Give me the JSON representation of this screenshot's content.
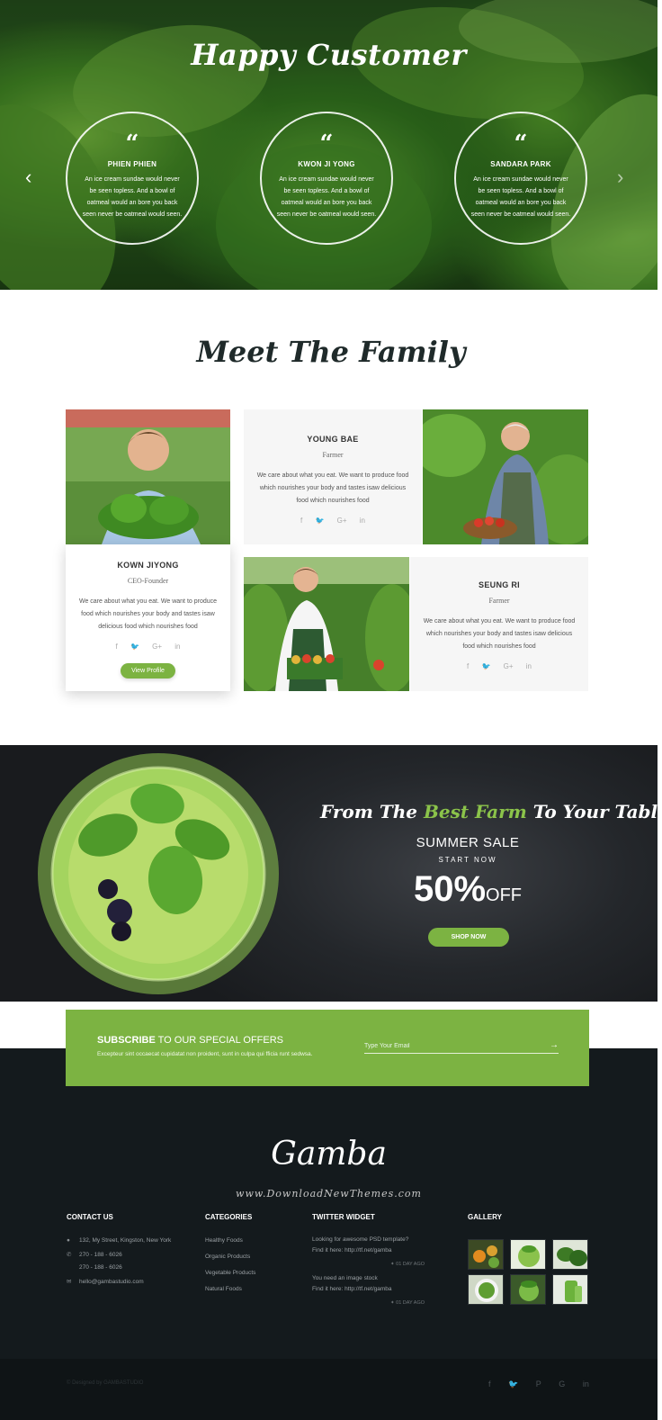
{
  "testimonials": {
    "title": "Happy Customer",
    "prev_icon": "chevron-left",
    "next_icon": "chevron-right",
    "items": [
      {
        "quote_mark": "“",
        "name": "PHIEN PHIEN",
        "text": "An ice cream sundae would never be seen topless. And a bowl of oatmeal would an bore you back seen never be oatmeal would seen."
      },
      {
        "quote_mark": "“",
        "name": "KWON JI YONG",
        "text": "An ice cream sundae would never be seen topless. And a bowl of oatmeal would an bore you back seen never be oatmeal would seen."
      },
      {
        "quote_mark": "“",
        "name": "SANDARA PARK",
        "text": "An ice cream sundae would never be seen topless. And a bowl of oatmeal would an bore you back seen never be oatmeal would seen."
      }
    ]
  },
  "family": {
    "title": "Meet The Family",
    "members": [
      {
        "name": "KOWN JIYONG",
        "role": "CEO-Founder",
        "text": "We care about what you eat. We want to produce food which nourishes your body and tastes isaw delicious food which nourishes food",
        "button": "View Profile"
      },
      {
        "name": "YOUNG BAE",
        "role": "Farmer",
        "text": "We care about what you eat. We want to produce food which nourishes your body and tastes isaw delicious food which nourishes food"
      },
      {
        "name": "SEUNG RI",
        "role": "Farmer",
        "text": "We care about what you eat. We want to produce food which nourishes your body and tastes isaw delicious food which nourishes food"
      }
    ],
    "social_icons": [
      "f",
      "🐦",
      "G+",
      "in"
    ]
  },
  "sale": {
    "heading_before": "From The ",
    "heading_accent": "Best Farm",
    "heading_after": " To Your Table",
    "subtitle": "SUMMER SALE",
    "start": "START NOW",
    "percent": "50%",
    "off": "OFF",
    "button": "SHOP NOW",
    "accent_color": "#8bc34a"
  },
  "subscribe": {
    "title_bold": "SUBSCRIBE",
    "title_rest": " TO OUR SPECIAL OFFERS",
    "desc": "Excepteur sint occaecat cupidatat non proident, sunt in culpa qui fficia runt sedwsa.",
    "placeholder": "Type Your Email",
    "send_icon": "→"
  },
  "footer": {
    "brand": "Gamba",
    "watermark": "www.DownloadNewThemes.com",
    "contact": {
      "title": "CONTACT US",
      "address": "132, My Street, Kingston, New York",
      "phone1": "270 - 188 - 6026",
      "phone2": "270 - 188 - 6026",
      "email": "hello@gambastudio.com"
    },
    "categories": {
      "title": "CATEGORIES",
      "items": [
        "Healthy Foods",
        "Organic Products",
        "Vegetable Products",
        "Natural Foods"
      ]
    },
    "twitter": {
      "title": "TWITTER WIDGET",
      "tweets": [
        {
          "line1": "Looking for awesome PSD template?",
          "line2": "Find it here: http://tf.net/gamba",
          "meta": "01 DAY AGO"
        },
        {
          "line1": "You need an image stock",
          "line2": "Find it here: http://tf.net/gamba",
          "meta": "01 DAY AGO"
        }
      ]
    },
    "gallery": {
      "title": "GALLERY"
    },
    "copyright": "© Designed by GAMBASTUDIO",
    "social_icons": [
      "f",
      "🐦",
      "P",
      "G",
      "in"
    ]
  },
  "colors": {
    "brand_green": "#7cb342",
    "footer_dark": "#141a1d"
  }
}
